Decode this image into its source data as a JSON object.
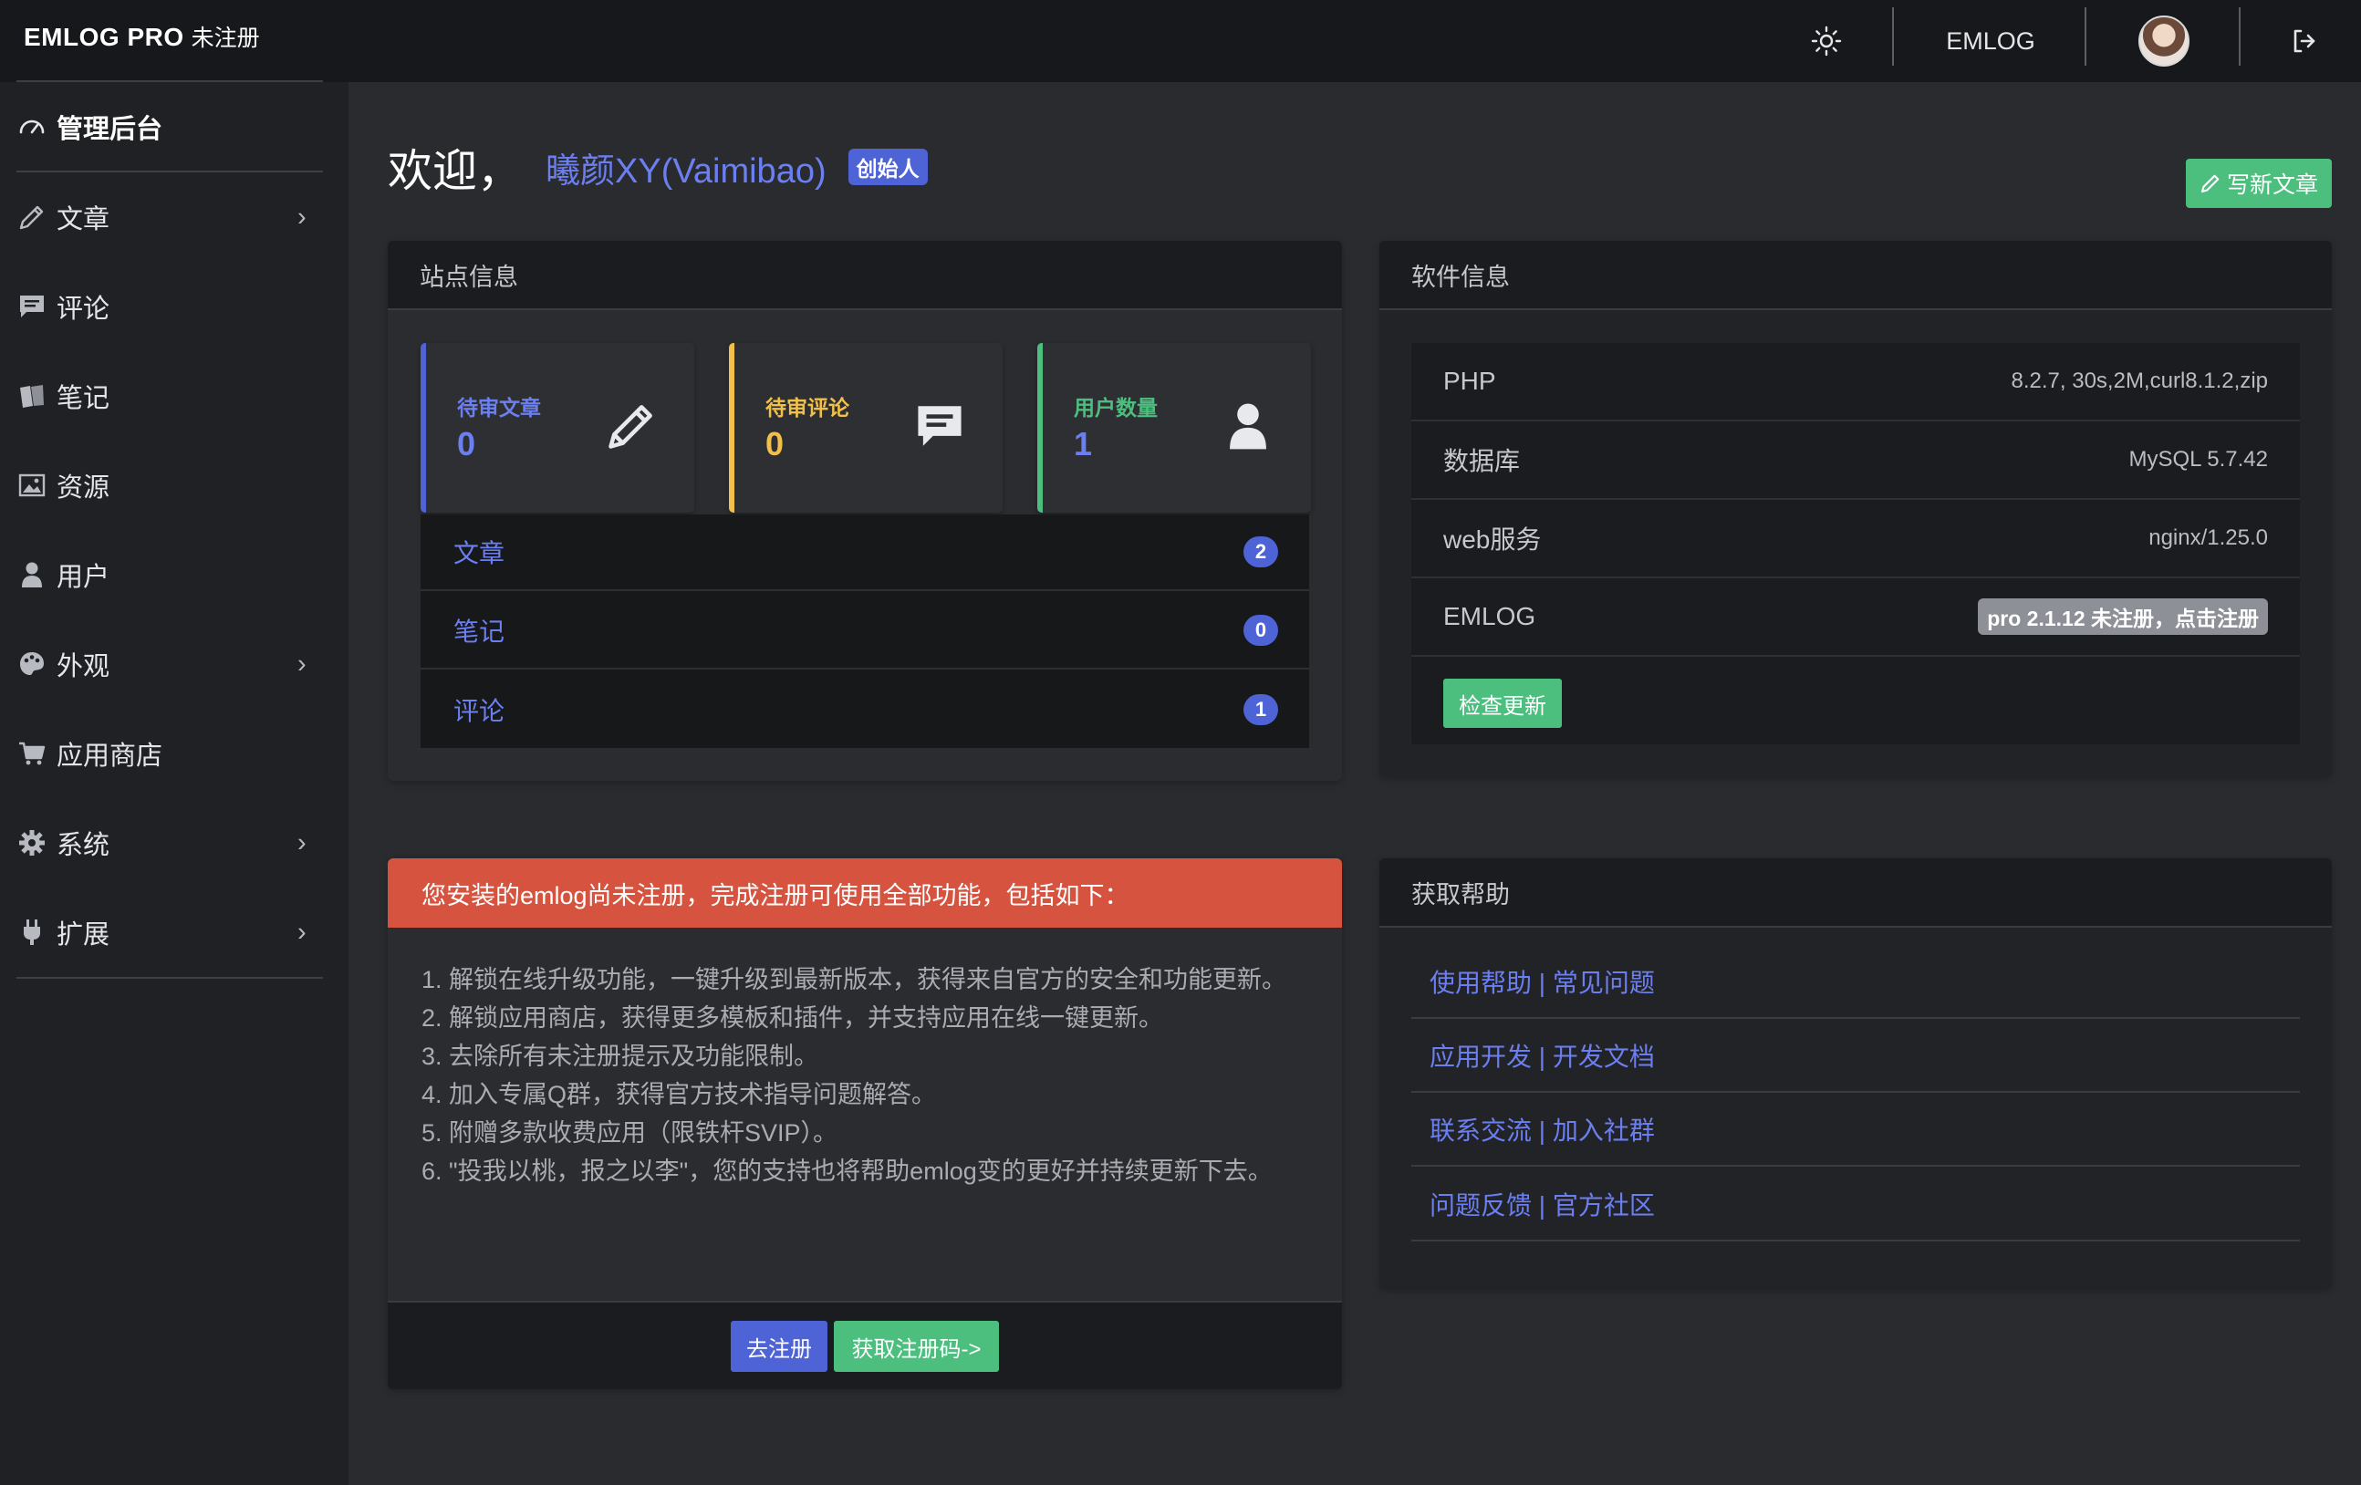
{
  "topbar": {
    "brand_main": "EMLOG PRO",
    "brand_sub": "未注册",
    "theme_icon": "sun-icon",
    "user_name": "EMLOG",
    "logout_icon": "logout-icon"
  },
  "sidebar": {
    "items": [
      {
        "label": "管理后台",
        "icon": "dashboard-icon",
        "has_submenu": false,
        "active": true
      },
      {
        "label": "文章",
        "icon": "pencil-icon",
        "has_submenu": true
      },
      {
        "label": "评论",
        "icon": "comment-icon",
        "has_submenu": false
      },
      {
        "label": "笔记",
        "icon": "note-icon",
        "has_submenu": false
      },
      {
        "label": "资源",
        "icon": "image-icon",
        "has_submenu": false
      },
      {
        "label": "用户",
        "icon": "user-icon",
        "has_submenu": false
      },
      {
        "label": "外观",
        "icon": "palette-icon",
        "has_submenu": true
      },
      {
        "label": "应用商店",
        "icon": "cart-icon",
        "has_submenu": false
      },
      {
        "label": "系统",
        "icon": "gear-icon",
        "has_submenu": true
      },
      {
        "label": "扩展",
        "icon": "plug-icon",
        "has_submenu": true
      }
    ],
    "chevron": "›"
  },
  "welcome": {
    "text": "欢迎，",
    "user": "曦颜XY(Vaimibao)",
    "badge": "创始人"
  },
  "write_button": "写新文章",
  "site_info": {
    "title": "站点信息",
    "stats": [
      {
        "label": "待审文章",
        "value": "0",
        "color": "#4e63d6",
        "icon": "pencil-icon"
      },
      {
        "label": "待审评论",
        "value": "0",
        "color": "#f0c04b",
        "icon": "comment-icon"
      },
      {
        "label": "用户数量",
        "value": "1",
        "color": "#4cbf7f",
        "icon": "user-icon"
      }
    ],
    "rows": [
      {
        "label": "文章",
        "count": "2"
      },
      {
        "label": "笔记",
        "count": "0"
      },
      {
        "label": "评论",
        "count": "1"
      }
    ]
  },
  "software_info": {
    "title": "软件信息",
    "rows": [
      {
        "label": "PHP",
        "value": "8.2.7, 30s,2M,curl8.1.2,zip"
      },
      {
        "label": "数据库",
        "value": "MySQL 5.7.42"
      },
      {
        "label": "web服务",
        "value": "nginx/1.25.0"
      },
      {
        "label": "EMLOG",
        "value": "pro 2.1.12 未注册，点击注册"
      }
    ],
    "check_button": "检查更新"
  },
  "register": {
    "title": "您安装的emlog尚未注册，完成注册可使用全部功能，包括如下：",
    "items": [
      "1. 解锁在线升级功能，一键升级到最新版本，获得来自官方的安全和功能更新。",
      "2. 解锁应用商店，获得更多模板和插件，并支持应用在线一键更新。",
      "3. 去除所有未注册提示及功能限制。",
      "4. 加入专属Q群，获得官方技术指导问题解答。",
      "5. 附赠多款收费应用（限铁杆SVIP）。",
      "6. \"投我以桃，报之以李\"，您的支持也将帮助emlog变的更好并持续更新下去。"
    ],
    "register_button": "去注册",
    "get_code_button": "获取注册码->"
  },
  "help": {
    "title": "获取帮助",
    "links": [
      "使用帮助 | 常见问题",
      "应用开发 | 开发文档",
      "联系交流 | 加入社群",
      "问题反馈 | 官方社区"
    ]
  },
  "colors": {
    "accent_blue": "#4e63d6",
    "link_blue": "#6c7ff0",
    "success_green": "#4cbf7f",
    "warning_yellow": "#f0c04b",
    "danger_red": "#d6533f"
  }
}
